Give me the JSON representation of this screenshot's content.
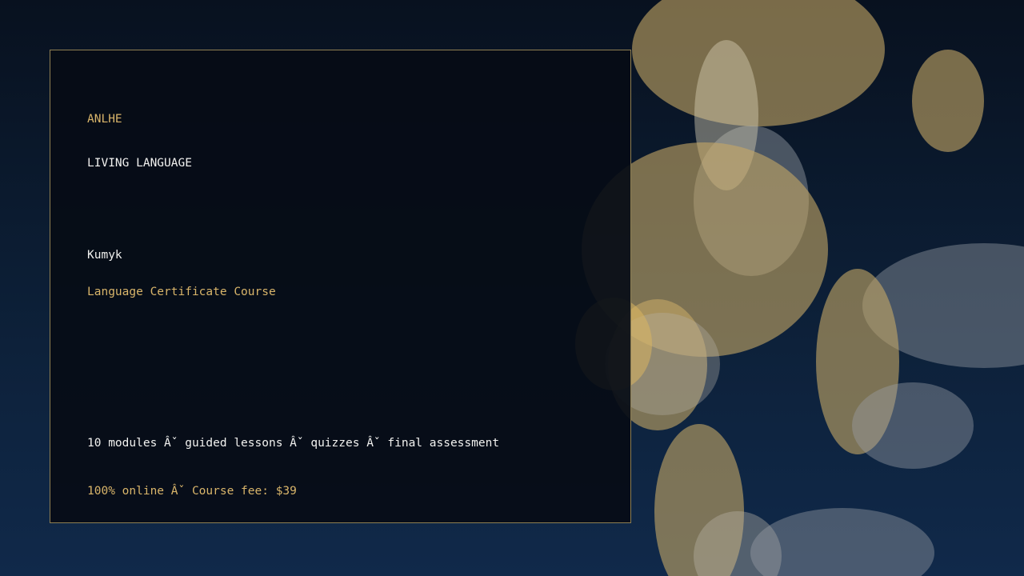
{
  "brand": "ANLHE",
  "kicker": "LIVING LANGUAGE",
  "language": "Kumyk",
  "course_title": "Language Certificate Course",
  "features": "10 modules Âˇ guided lessons Âˇ quizzes Âˇ final assessment",
  "pricing": "100% online Âˇ Course fee: $39",
  "colors": {
    "accent_gold": "#d9b56a",
    "text_white": "#f2f2f0",
    "card_border": "#8f7f52",
    "background_top": "#08111f",
    "background_bottom": "#10294a"
  }
}
